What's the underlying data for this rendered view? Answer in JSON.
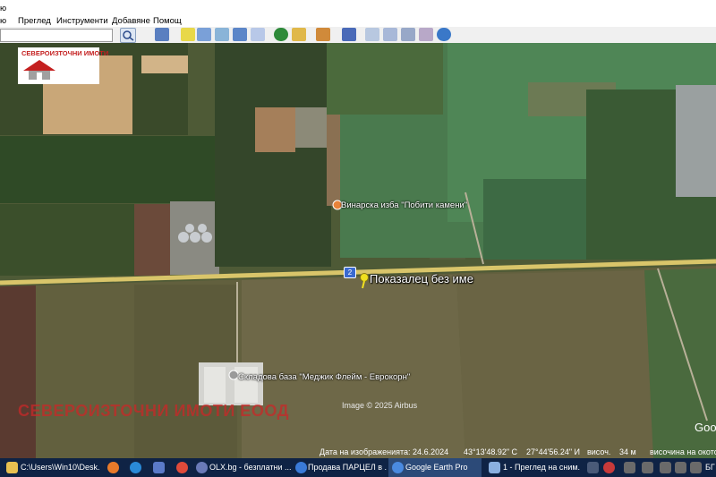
{
  "window": {
    "title_fragment": "ю"
  },
  "menu": {
    "items": [
      "Преглед",
      "Инструменти",
      "Добавяне",
      "Помощ"
    ]
  },
  "logo": {
    "text": "СЕВЕРОИЗТОЧНИ ИМОТИ"
  },
  "watermark": {
    "text": "СЕВЕРОИЗТОЧНИ ИМОТИ ЕООД"
  },
  "places": {
    "winery": "Винарска изба \"Побити камени\"",
    "base": "Складова база \"Меджик Флейм - Еврокорн\""
  },
  "road_shield": "2",
  "pin": {
    "label": "Показалец без име"
  },
  "copyright": "Image © 2025 Airbus",
  "google_mark": "Goo",
  "status": {
    "date_label": "Дата на изображенията: 24.6.2024",
    "lat": "43°13'48.92\" С",
    "lon": "27°44'56.24\" И",
    "elev_label": "височ.",
    "elev_value": "34 м",
    "eye_label": "височина на окото"
  },
  "taskbar": {
    "items": [
      {
        "label": "C:\\Users\\Win10\\Desk..."
      },
      {
        "label": "OLX.bg - безплатни ..."
      },
      {
        "label": "Продава ПАРЦЕЛ в ..."
      },
      {
        "label": "Google Earth Pro"
      },
      {
        "label": "1 - Преглед на сним..."
      }
    ],
    "lang": "БГ"
  }
}
